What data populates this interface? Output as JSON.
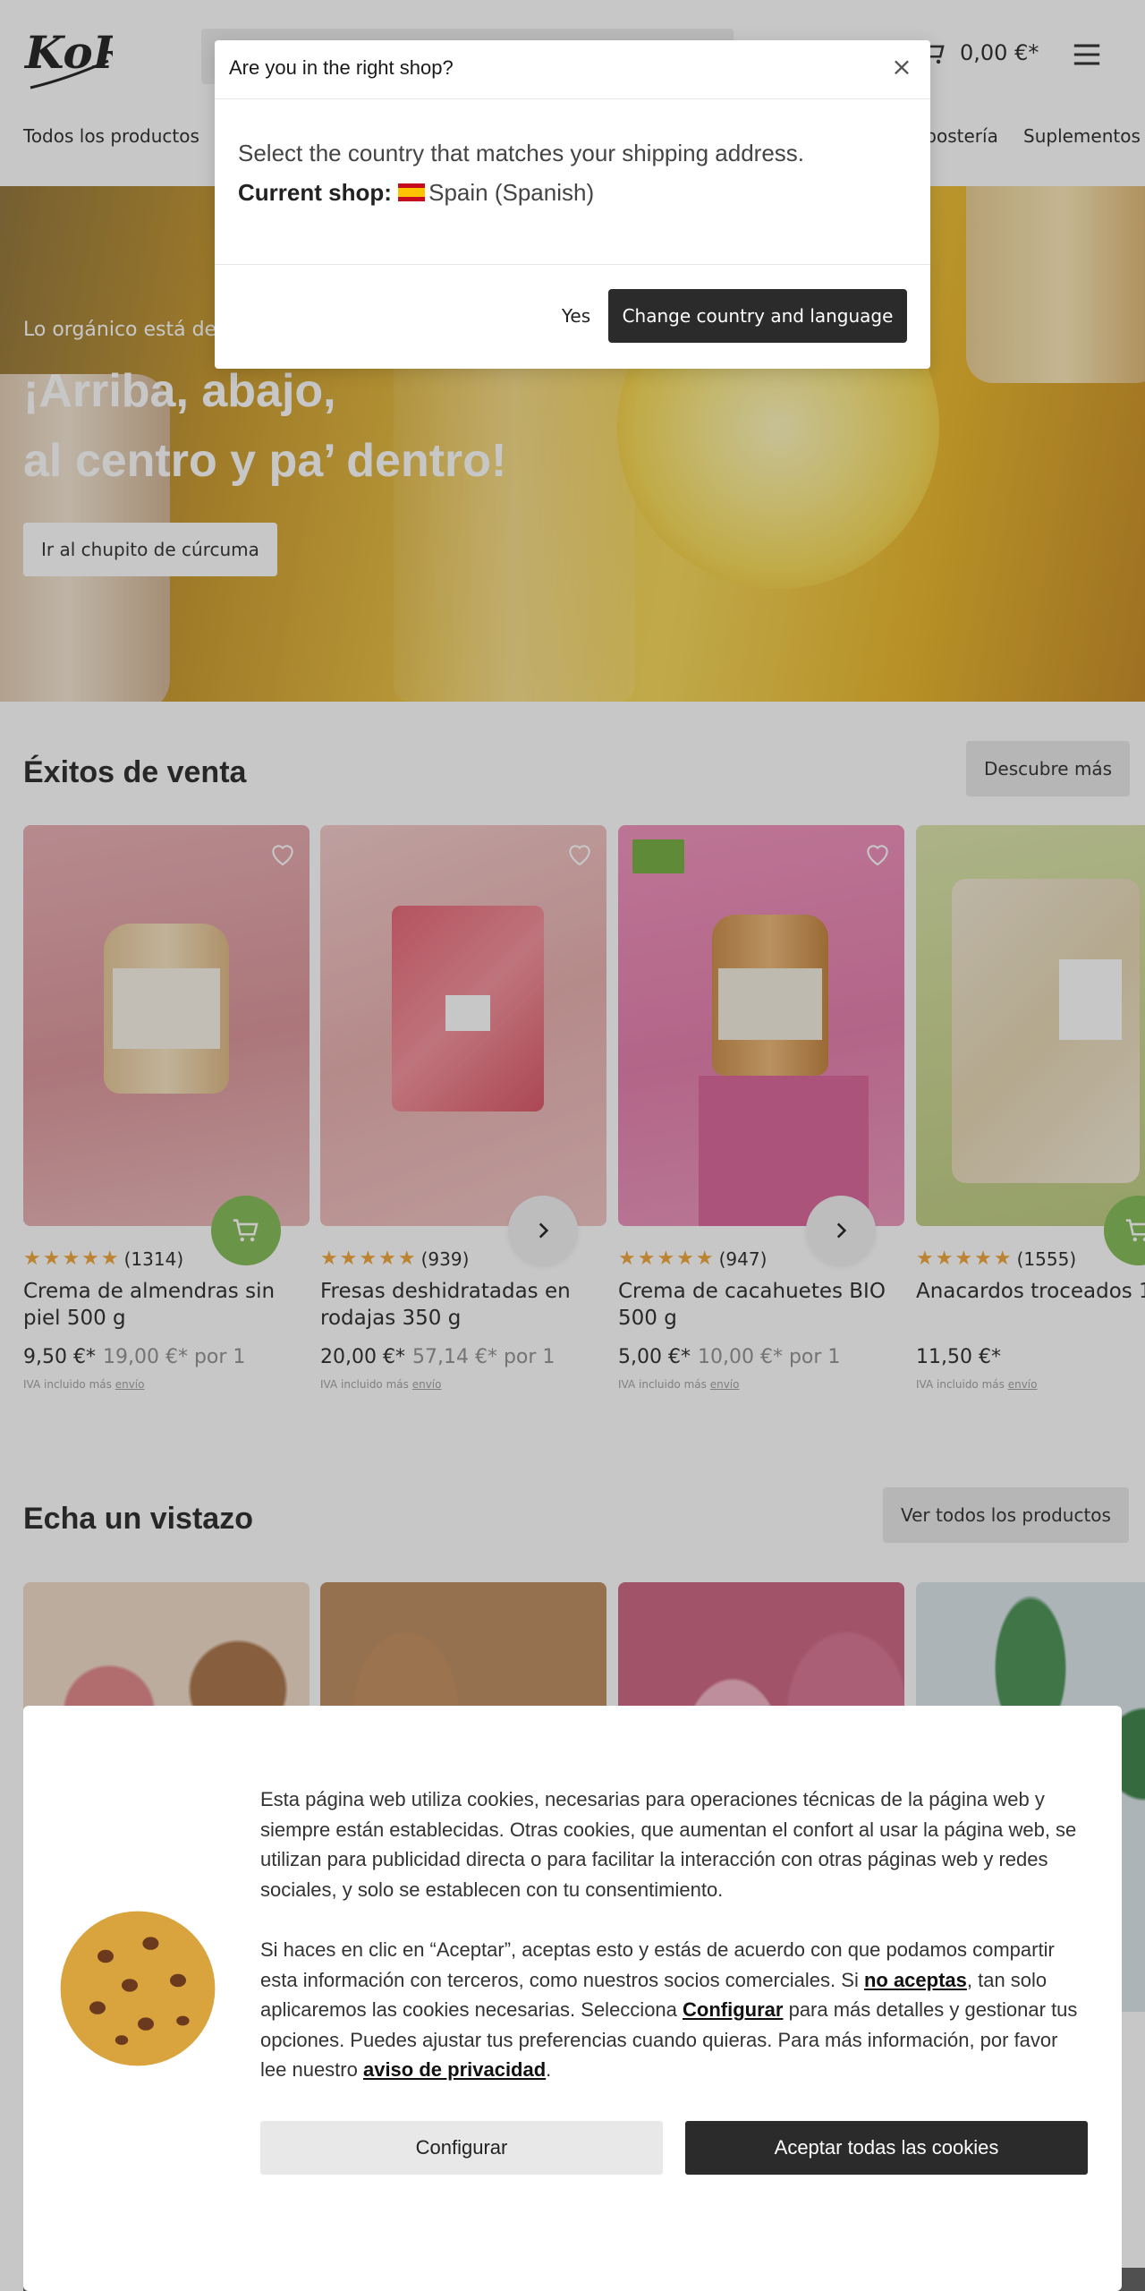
{
  "header": {
    "logo_text": "KoRo",
    "cart_total": "0,00 €*",
    "nav": [
      {
        "label": "Todos los productos"
      },
      {
        "label": "Repostería"
      },
      {
        "label": "Suplementos"
      }
    ]
  },
  "hero": {
    "kicker": "Lo orgánico está de",
    "title_line1": "¡Arriba, abajo,",
    "title_line2": "al centro y pa’ dentro!",
    "button": "Ir al chupito de cúrcuma"
  },
  "bestsellers": {
    "title": "Éxitos de venta",
    "more": "Descubre más",
    "products": [
      {
        "name": "Crema de almendras sin piel 500 g",
        "reviews": "(1314)",
        "price": "9,50 €*",
        "unit_price": "19,00 €* por 1",
        "tax": "IVA incluido más",
        "shipping": "envío"
      },
      {
        "name": "Fresas deshidratadas en rodajas 350 g",
        "reviews": "(939)",
        "price": "20,00 €*",
        "unit_price": "57,14 €* por 1",
        "tax": "IVA incluido más",
        "shipping": "envío"
      },
      {
        "name": "Crema de cacahuetes BIO 500 g",
        "reviews": "(947)",
        "price": "5,00 €*",
        "unit_price": "10,00 €* por 1",
        "tax": "IVA incluido más",
        "shipping": "envío"
      },
      {
        "name": "Anacardos troceados 1",
        "reviews": "(1555)",
        "price": "11,50 €*",
        "unit_price": "",
        "tax": "IVA incluido más",
        "shipping": "envío"
      }
    ]
  },
  "browse": {
    "title": "Echa un vistazo",
    "more": "Ver todos los productos"
  },
  "modal": {
    "title": "Are you in the right shop?",
    "close": "×",
    "line1": "Select the country that matches your shipping address.",
    "current_label": "Current shop:",
    "current_value": "Spain (Spanish)",
    "yes": "Yes",
    "change": "Change country and language"
  },
  "cookie": {
    "p1": "Esta página web utiliza cookies, necesarias para operaciones técnicas de la página web y siempre están establecidas. Otras cookies, que aumentan el confort al usar la página web, se utilizan para publicidad directa o para facilitar la interacción con otras páginas web y redes sociales, y solo se establecen con tu consentimiento.",
    "p2a": "Si haces en clic en “Aceptar”, aceptas esto y estás de acuerdo con que podamos compartir esta información con terceros, como nuestros socios comerciales. Si ",
    "link_reject": "no aceptas",
    "p2b": ", tan solo aplicaremos las cookies necesarias. Selecciona ",
    "link_config": "Configurar",
    "p2c": " para más detalles y gestionar tus opciones. Puedes ajustar tus preferencias cuando quieras. Para más información, por favor lee nuestro ",
    "link_privacy": "aviso de privacidad",
    "p2d": ".",
    "btn_config": "Configurar",
    "btn_accept": "Aceptar todas las cookies"
  }
}
